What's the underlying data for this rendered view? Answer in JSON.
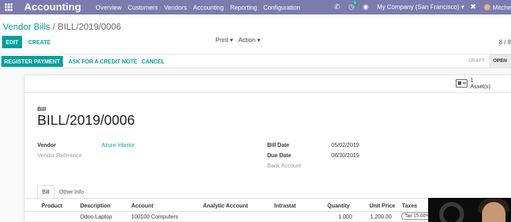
{
  "navbar": {
    "app_name": "Accounting",
    "menu": [
      "Overview",
      "Customers",
      "Vendors",
      "Accounting",
      "Reporting",
      "Configuration"
    ],
    "chat_badge": "8",
    "company": "My Company (San Francisco)",
    "user": "Mitche"
  },
  "control_panel": {
    "breadcrumb_parent": "Vendor Bills",
    "breadcrumb_sep": "/",
    "breadcrumb_current": "BILL/2019/0006",
    "edit_label": "EDIT",
    "create_label": "CREATE",
    "print_label": "Print",
    "action_label": "Action",
    "pager": "8 / 8"
  },
  "statusbar": {
    "register_payment": "REGISTER PAYMENT",
    "credit_note": "ASK FOR A CREDIT NOTE",
    "cancel": "CANCEL",
    "stages": [
      "DRAFT",
      "OPEN"
    ],
    "active_stage": "OPEN"
  },
  "smart_button": {
    "count": "1",
    "label": "Asset(s)"
  },
  "form": {
    "type_label": "Bill",
    "number": "BILL/2019/0006",
    "vendor_label": "Vendor",
    "vendor_value": "Azure Interior",
    "vendor_ref_label": "Vendor Reference",
    "bill_date_label": "Bill Date",
    "bill_date_value": "05/02/2019",
    "due_date_label": "Due Date",
    "due_date_value": "06/30/2019",
    "bank_account_label": "Bank Account"
  },
  "tabs": [
    "Bill",
    "Other Info"
  ],
  "lines": {
    "columns": [
      "Product",
      "Description",
      "Account",
      "Analytic Account",
      "Intrastat",
      "Quantity",
      "Unit Price",
      "Taxes"
    ],
    "rows": [
      {
        "product": "",
        "description": "Odoo Laptop",
        "account": "100100 Computers",
        "analytic": "",
        "intrastat": "",
        "quantity": "1.000",
        "unit_price": "1,200.00",
        "taxes": "Tax 15.00%"
      }
    ]
  },
  "colors": {
    "navbar": "#7c7bad",
    "primary": "#00a09d"
  }
}
